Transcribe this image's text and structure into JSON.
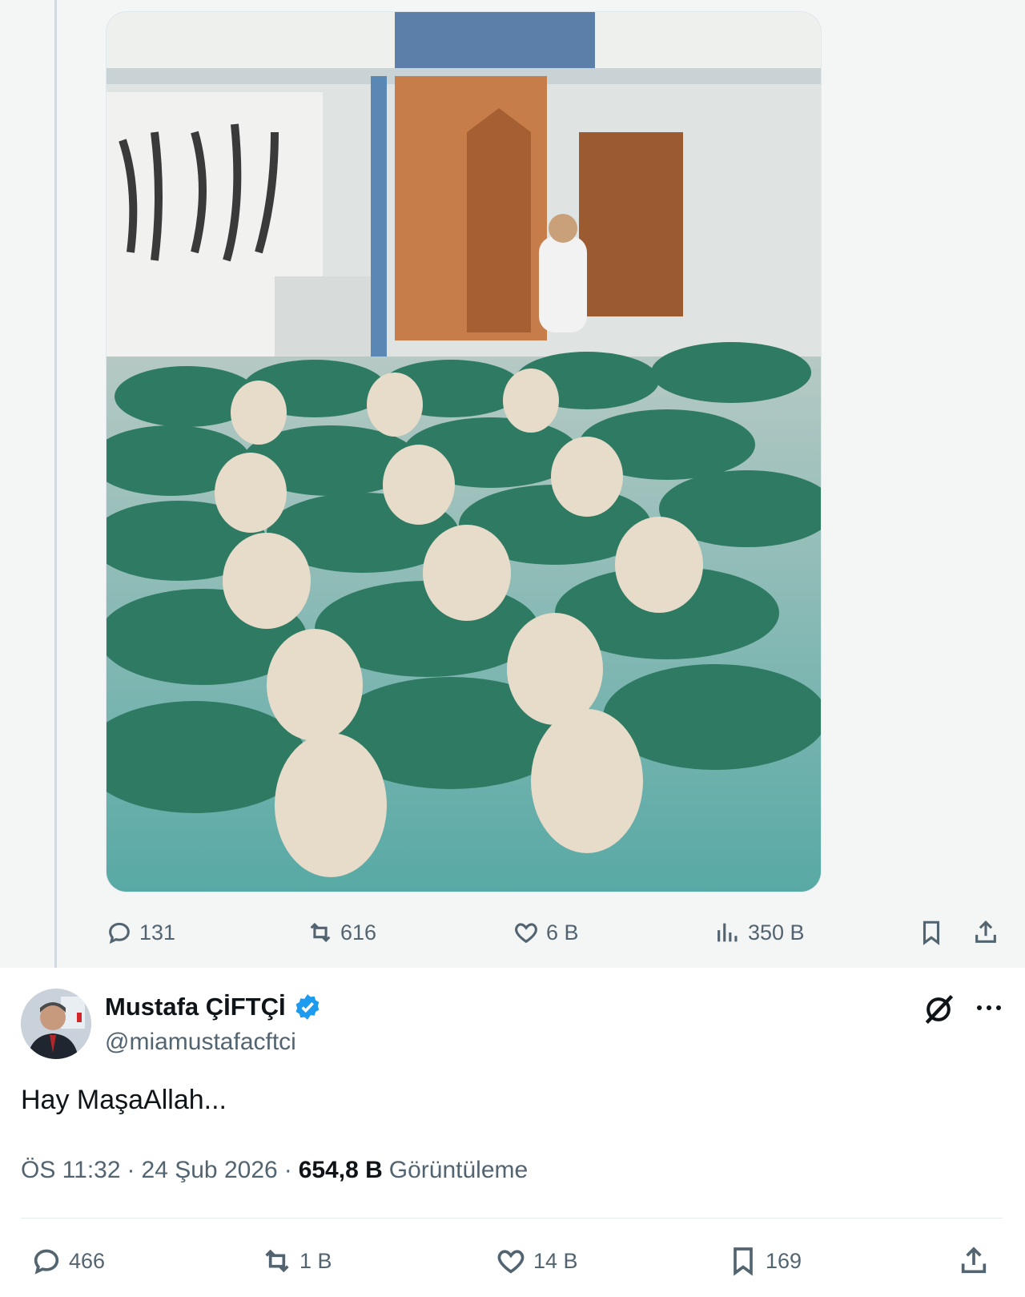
{
  "quoted_post": {
    "actions": {
      "reply_count": "131",
      "repost_count": "616",
      "like_count": "6 B",
      "view_count": "350 B"
    }
  },
  "post": {
    "author_name": "Mustafa ÇİFTÇİ",
    "author_handle": "@miamustafacftci",
    "text": "Hay MaşaAllah...",
    "time": "ÖS 11:32",
    "separator": "·",
    "date": "24 Şub 2026",
    "views_value": "654,8 B",
    "views_label": "Görüntüleme",
    "actions": {
      "reply_count": "466",
      "repost_count": "1 B",
      "like_count": "14 B",
      "bookmark_count": "169"
    }
  },
  "colors": {
    "secondary_text": "#536471",
    "primary_text": "#0f1419",
    "verified_blue": "#1d9bf0"
  }
}
